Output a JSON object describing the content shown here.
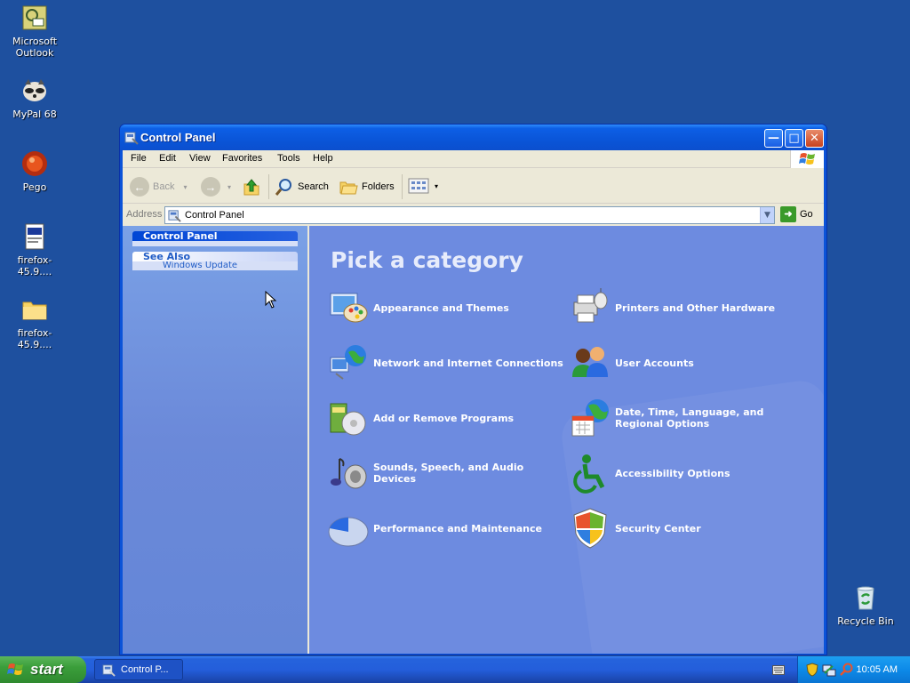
{
  "desktop": {
    "icons": [
      {
        "label": "Microsoft Outlook",
        "icon": "outlook-icon"
      },
      {
        "label": "MyPal 68",
        "icon": "mypal-icon"
      },
      {
        "label": "Pego",
        "icon": "pego-icon"
      },
      {
        "label": "firefox-45.9....",
        "icon": "file-icon"
      },
      {
        "label": "firefox-45.9....",
        "icon": "folder-icon"
      },
      {
        "label": "Recycle Bin",
        "icon": "recycle-bin-icon"
      }
    ]
  },
  "window": {
    "title": "Control Panel",
    "menu": [
      "File",
      "Edit",
      "View",
      "Favorites",
      "Tools",
      "Help"
    ],
    "toolbar": {
      "back": "Back",
      "search": "Search",
      "folders": "Folders"
    },
    "address": {
      "label": "Address",
      "value": "Control Panel",
      "go": "Go"
    },
    "leftpane": {
      "box1_title": "Control Panel",
      "box2_title": "See Also",
      "box2_item": "Windows Update"
    },
    "main": {
      "heading": "Pick a category",
      "categories": [
        {
          "label": "Appearance and Themes",
          "icon": "appearance-themes-icon"
        },
        {
          "label": "Printers and Other Hardware",
          "icon": "printers-hardware-icon"
        },
        {
          "label": "Network and Internet Connections",
          "icon": "network-internet-icon"
        },
        {
          "label": "User Accounts",
          "icon": "user-accounts-icon"
        },
        {
          "label": "Add or Remove Programs",
          "icon": "add-remove-programs-icon"
        },
        {
          "label": "Date, Time, Language, and Regional Options",
          "icon": "date-time-regional-icon"
        },
        {
          "label": "Sounds, Speech, and Audio Devices",
          "icon": "sounds-audio-icon"
        },
        {
          "label": "Accessibility Options",
          "icon": "accessibility-icon"
        },
        {
          "label": "Performance and Maintenance",
          "icon": "performance-maintenance-icon"
        },
        {
          "label": "Security Center",
          "icon": "security-center-icon"
        }
      ]
    }
  },
  "taskbar": {
    "start": "start",
    "task_button": "Control P...",
    "clock": "10:05 AM"
  },
  "colors": {
    "desktop": "#1e509f",
    "titlebar": "#0b55d8",
    "main_pane": "#6d8be0",
    "start_green": "#3b9e3b"
  }
}
